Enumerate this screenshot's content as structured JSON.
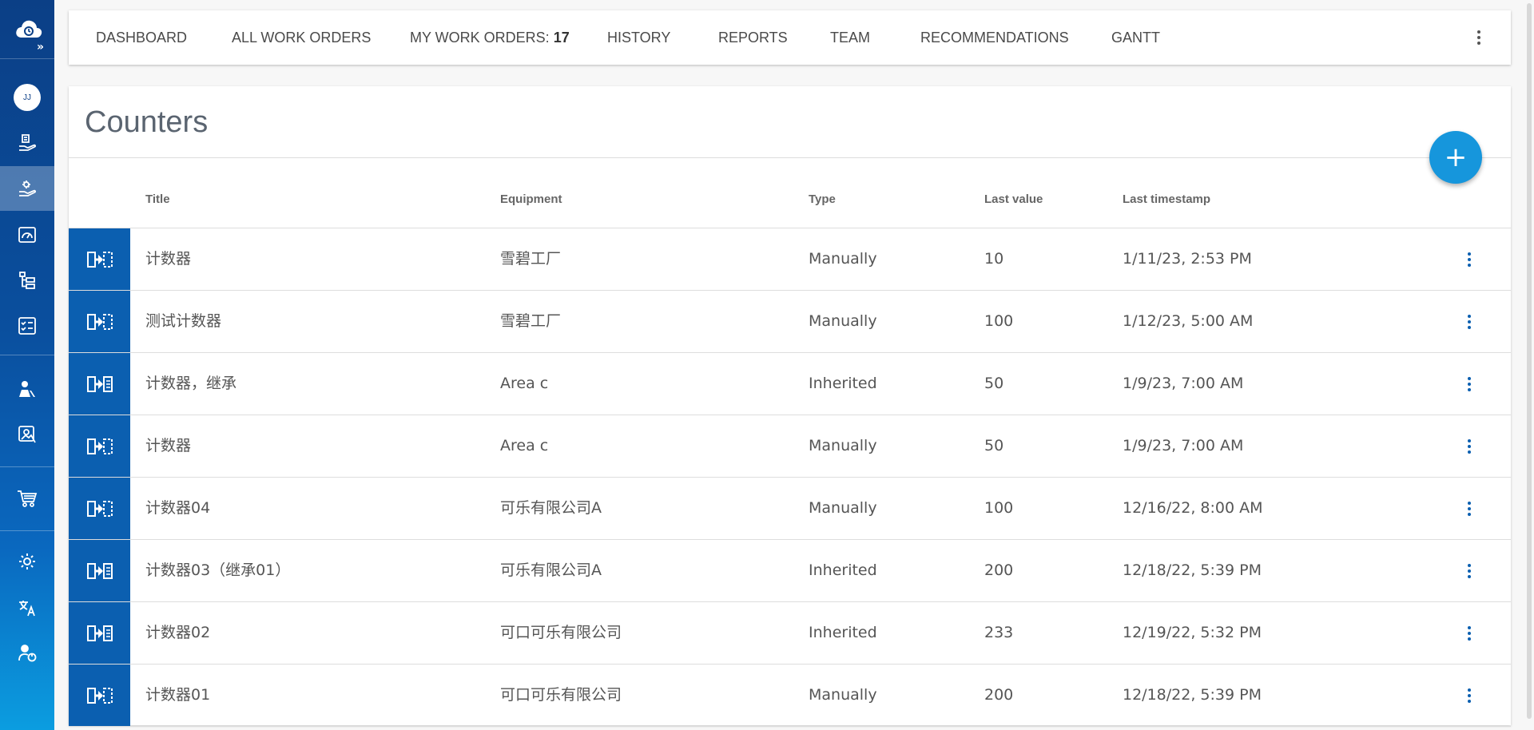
{
  "sidebar": {
    "avatar_initials": "JJ",
    "items": [
      {
        "icon": "hand-calendar-icon",
        "active": false
      },
      {
        "icon": "hand-gear-icon",
        "active": true
      },
      {
        "icon": "gauge-icon",
        "active": false
      },
      {
        "icon": "hierarchy-icon",
        "active": false
      },
      {
        "icon": "checklist-icon",
        "active": false
      },
      {
        "icon": "person-tools-icon",
        "active": false
      },
      {
        "icon": "equipment-photo-icon",
        "active": false
      },
      {
        "icon": "shopping-cart-icon",
        "active": false
      },
      {
        "icon": "brightness-icon",
        "active": false
      },
      {
        "icon": "translate-icon",
        "active": false
      },
      {
        "icon": "user-power-icon",
        "active": false
      }
    ]
  },
  "nav": {
    "dashboard": "DASHBOARD",
    "all_work_orders": "ALL WORK ORDERS",
    "my_work_orders": "MY WORK ORDERS:",
    "my_work_orders_count": "17",
    "history": "HISTORY",
    "reports": "REPORTS",
    "team": "TEAM",
    "recommendations": "RECOMMENDATIONS",
    "gantt": "GANTT"
  },
  "page": {
    "title": "Counters",
    "add_button": "+"
  },
  "table": {
    "columns": {
      "title": "Title",
      "equipment": "Equipment",
      "type": "Type",
      "last_value": "Last value",
      "last_timestamp": "Last timestamp"
    },
    "rows": [
      {
        "title": "计数器",
        "equipment": "雪碧工厂",
        "type": "Manually",
        "last_value": "10",
        "last_timestamp": "1/11/23, 2:53 PM",
        "icon": "counter-manual-icon"
      },
      {
        "title": "测试计数器",
        "equipment": "雪碧工厂",
        "type": "Manually",
        "last_value": "100",
        "last_timestamp": "1/12/23, 5:00 AM",
        "icon": "counter-manual-icon"
      },
      {
        "title": "计数器，继承",
        "equipment": "Area c",
        "type": "Inherited",
        "last_value": "50",
        "last_timestamp": "1/9/23, 7:00 AM",
        "icon": "counter-inherited-icon"
      },
      {
        "title": "计数器",
        "equipment": "Area c",
        "type": "Manually",
        "last_value": "50",
        "last_timestamp": "1/9/23, 7:00 AM",
        "icon": "counter-manual-icon"
      },
      {
        "title": "计数器04",
        "equipment": "可乐有限公司A",
        "type": "Manually",
        "last_value": "100",
        "last_timestamp": "12/16/22, 8:00 AM",
        "icon": "counter-manual-icon"
      },
      {
        "title": "计数器03（继承01）",
        "equipment": "可乐有限公司A",
        "type": "Inherited",
        "last_value": "200",
        "last_timestamp": "12/18/22, 5:39 PM",
        "icon": "counter-inherited-icon"
      },
      {
        "title": "计数器02",
        "equipment": "可口可乐有限公司",
        "type": "Inherited",
        "last_value": "233",
        "last_timestamp": "12/19/22, 5:32 PM",
        "icon": "counter-inherited-icon"
      },
      {
        "title": "计数器01",
        "equipment": "可口可乐有限公司",
        "type": "Manually",
        "last_value": "200",
        "last_timestamp": "12/18/22, 5:39 PM",
        "icon": "counter-manual-icon"
      }
    ]
  },
  "colors": {
    "accent": "#0b5fb0",
    "fab": "#1696dc",
    "sidebar_top": "#0b3f86",
    "sidebar_bottom": "#0b9de0"
  }
}
